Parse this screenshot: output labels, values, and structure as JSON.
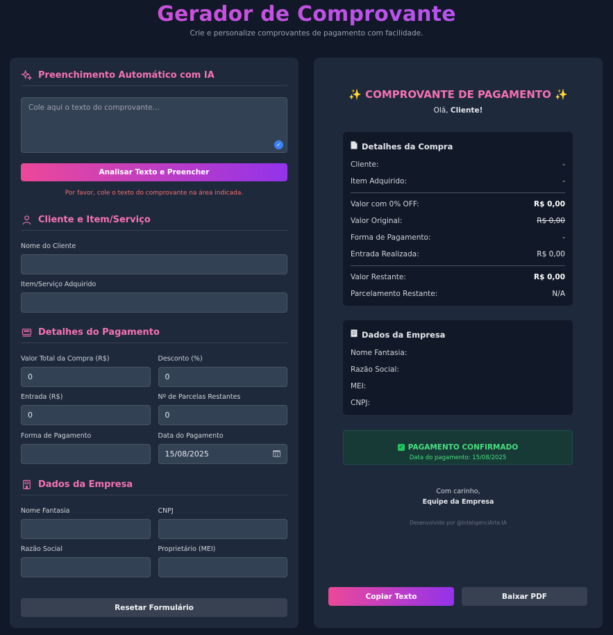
{
  "header": {
    "title": "Gerador de Comprovante",
    "subtitle": "Crie e personalize comprovantes de pagamento com facilidade."
  },
  "ai": {
    "title": "Preenchimento Automático com IA",
    "icon": "sparkles-icon",
    "placeholder": "Cole aqui o texto do comprovante...",
    "analyze_label": "Analisar Texto e Preencher",
    "error": "Por favor, cole o texto do comprovante na área indicada."
  },
  "client": {
    "title": "Cliente e Item/Serviço",
    "icon": "user-icon",
    "name_label": "Nome do Cliente",
    "name_value": "",
    "item_label": "Item/Serviço Adquirido",
    "item_value": ""
  },
  "payment": {
    "title": "Detalhes do Pagamento",
    "icon": "register-icon",
    "total_label": "Valor Total da Compra (R$)",
    "total_value": "0",
    "discount_label": "Desconto (%)",
    "discount_value": "0",
    "entry_label": "Entrada (R$)",
    "entry_value": "0",
    "installments_label": "Nº de Parcelas Restantes",
    "installments_value": "0",
    "method_label": "Forma de Pagamento",
    "method_value": "",
    "date_label": "Data do Pagamento",
    "date_value": "15/08/2025"
  },
  "company": {
    "title": "Dados da Empresa",
    "icon": "building-icon",
    "trade_label": "Nome Fantasia",
    "cnpj_label": "CNPJ",
    "legal_label": "Razão Social",
    "owner_label": "Proprietário (MEI)"
  },
  "reset_label": "Resetar Formulário",
  "receipt": {
    "title": "✨ COMPROVANTE DE PAGAMENTO ✨",
    "greeting_prefix": "Olá, ",
    "greeting_name": "Cliente!",
    "purchase": {
      "title": "Detalhes da Compra",
      "rows_top": [
        {
          "label": "Cliente:",
          "value": "-"
        },
        {
          "label": "Item Adquirido:",
          "value": "-"
        }
      ],
      "rows_mid": [
        {
          "label": "Valor com 0% OFF:",
          "value": "R$ 0,00"
        },
        {
          "label": "Valor Original:",
          "value": "R$ 0,00"
        },
        {
          "label": "Forma de Pagamento:",
          "value": "-"
        },
        {
          "label": "Entrada Realizada:",
          "value": "R$ 0,00"
        }
      ],
      "rows_bottom": [
        {
          "label": "Valor Restante:",
          "value": "R$ 0,00"
        },
        {
          "label": "Parcelamento Restante:",
          "value": "N/A"
        }
      ]
    },
    "company": {
      "title": "Dados da Empresa",
      "rows": [
        "Nome Fantasia:",
        "Razão Social:",
        "MEI:",
        "CNPJ:"
      ]
    },
    "confirmed": "PAGAMENTO CONFIRMADO",
    "confirmed_date": "Data do pagamento: 15/08/2025",
    "regards": "Com carinho,",
    "team": "Equipe da Empresa",
    "dev": "Desenvolvido por @InteligenciArte.IA"
  },
  "actions": {
    "copy_label": "Copiar Texto",
    "pdf_label": "Baixar PDF"
  },
  "colors": {
    "accent_pink": "#f472b6",
    "gradient_start": "#ec4899",
    "gradient_end": "#9333ea",
    "success": "#4ade80"
  }
}
